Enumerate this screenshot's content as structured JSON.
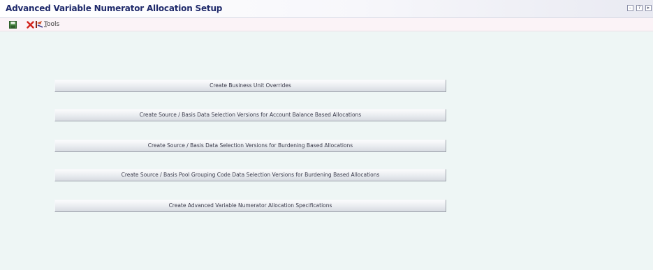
{
  "window": {
    "title": "Advanced Variable Numerator Allocation Setup"
  },
  "titlebar_icons": [
    {
      "icon": "window-min-icon",
      "glyph": "–"
    },
    {
      "icon": "help-icon",
      "glyph": "?"
    },
    {
      "icon": "popout-icon",
      "glyph": "▸"
    }
  ],
  "toolbar": {
    "save_icon": "save-icon",
    "close_icon": "close-icon",
    "tools_icon": "tools-icon",
    "tools_first_letter": "T",
    "tools_rest": "ools"
  },
  "actions": [
    {
      "label": "Create Business Unit Overrides"
    },
    {
      "label": "Create Source / Basis Data Selection Versions for Account Balance Based Allocations"
    },
    {
      "label": "Create Source / Basis Data Selection Versions for Burdening Based Allocations"
    },
    {
      "label": "Create Source / Basis Pool Grouping Code Data Selection Versions for Burdening Based Allocations"
    },
    {
      "label": "Create Advanced Variable Numerator Allocation Specifications"
    }
  ],
  "colors": {
    "title_text": "#1f2a6b",
    "background": "#eef6f5",
    "toolbar_bg": "#fbf3f7",
    "close_red": "#d2231c",
    "save_green": "#3d7a3a"
  }
}
